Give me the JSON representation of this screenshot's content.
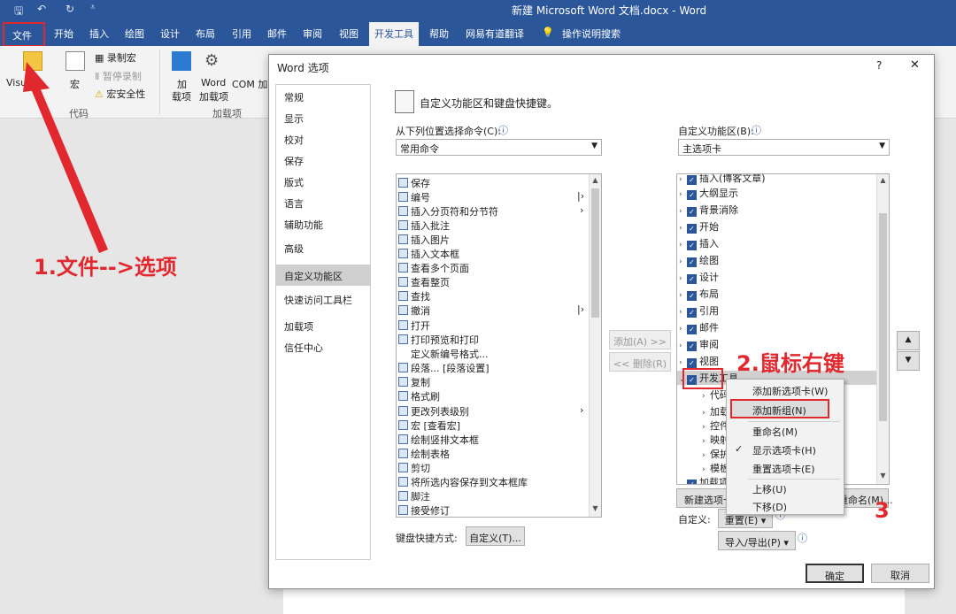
{
  "titlebar": {
    "window_title": "新建 Microsoft Word 文档.docx  -  Word",
    "save_icon": "save-icon",
    "undo_icon": "undo-icon",
    "redo_icon": "redo-icon",
    "customize_icon": "customize-qat-icon"
  },
  "tabs": [
    "文件",
    "开始",
    "插入",
    "绘图",
    "设计",
    "布局",
    "引用",
    "邮件",
    "审阅",
    "视图",
    "开发工具",
    "帮助",
    "网易有道翻译"
  ],
  "tell_me": "操作说明搜索",
  "ribbon": {
    "visual_basic": "Visual",
    "macros": "宏",
    "record_macro": "录制宏",
    "pause_recording": "暂停录制",
    "macro_security": "宏安全性",
    "code_group": "代码",
    "addins": "加\n载项",
    "addins_l1": "加",
    "addins_l2": "载项",
    "word_addins_l1": "Word",
    "word_addins_l2": "加载项",
    "com_addins": "COM 加",
    "addins_group": "加载项"
  },
  "annotations": {
    "step1": "1.文件-->选项",
    "step2": "2.鼠标右键",
    "step3": "3",
    "color": "#e0282e"
  },
  "dialog": {
    "title": "Word 选项",
    "help": "?",
    "close": "✕",
    "nav": [
      "常规",
      "显示",
      "校对",
      "保存",
      "版式",
      "语言",
      "辅助功能",
      "高级",
      "自定义功能区",
      "快速访问工具栏",
      "加载项",
      "信任中心"
    ],
    "nav_selected": "自定义功能区",
    "heading": "自定义功能区和键盘快捷键。",
    "choose_label": "从下列位置选择命令(C):",
    "choose_value": "常用命令",
    "customize_label": "自定义功能区(B):",
    "customize_value": "主选项卡",
    "commands": [
      "保存",
      "编号",
      "插入分页符和分节符",
      "插入批注",
      "插入图片",
      "插入文本框",
      "查看多个页面",
      "查看整页",
      "查找",
      "撤消",
      "打开",
      "打印预览和打印",
      "定义新编号格式...",
      "段落... [段落设置]",
      "复制",
      "格式刷",
      "更改列表级别",
      "宏 [查看宏]",
      "绘制竖排文本框",
      "绘制表格",
      "剪切",
      "将所选内容保存到文本框库",
      "脚注",
      "接受修订"
    ],
    "ribbon_tree": [
      "插入(博客文章)",
      "大纲显示",
      "背景消除",
      "开始",
      "插入",
      "绘图",
      "设计",
      "布局",
      "引用",
      "邮件",
      "审阅",
      "视图",
      "开发工具",
      "代码",
      "加载项",
      "控件",
      "映射",
      "保护",
      "模板",
      "加载项"
    ],
    "add_button": "添加(A) >>",
    "remove_button": "<< 删除(R)",
    "keyboard_label": "键盘快捷方式:",
    "customize_button": "自定义(T)...",
    "new_tab_button": "新建选项卡",
    "rename_button": "重命名(M)...",
    "custom_label": "自定义:",
    "reset_button": "重置(E) ▾",
    "import_export_button": "导入/导出(P) ▾",
    "ok": "确定",
    "cancel": "取消"
  },
  "context_menu": [
    "添加新选项卡(W)",
    "添加新组(N)",
    "重命名(M)",
    "显示选项卡(H)",
    "重置选项卡(E)",
    "上移(U)",
    "下移(D)"
  ]
}
